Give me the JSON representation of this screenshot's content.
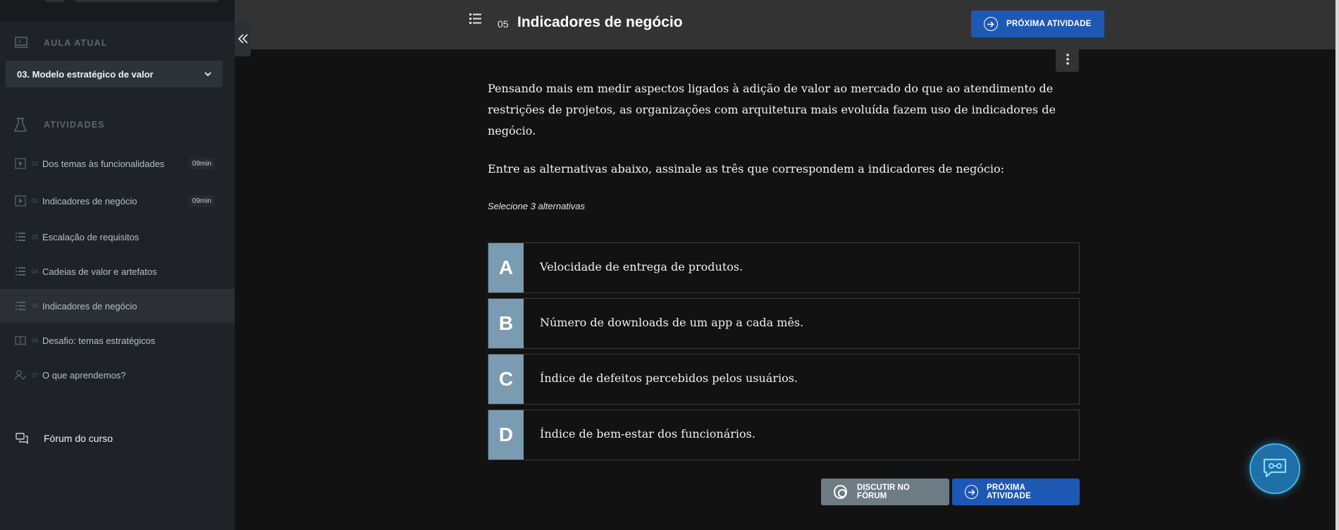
{
  "sidebar": {
    "current_lesson_label": "AULA ATUAL",
    "current_lesson_value": "03. Modelo estratégico de valor",
    "activities_label": "ATIVIDADES",
    "activities": [
      {
        "num": "01",
        "label": "Dos temas às funcionalidades",
        "duration": "09min",
        "icon": "play-icon"
      },
      {
        "num": "02",
        "label": "Indicadores de negócio",
        "duration": "09min",
        "icon": "play-icon"
      },
      {
        "num": "03",
        "label": "Escalação de requisitos",
        "duration": "",
        "icon": "list-icon"
      },
      {
        "num": "04",
        "label": "Cadeias de valor e artefatos",
        "duration": "",
        "icon": "list-icon"
      },
      {
        "num": "05",
        "label": "Indicadores de negócio",
        "duration": "",
        "icon": "list-icon"
      },
      {
        "num": "06",
        "label": "Desafio: temas estratégicos",
        "duration": "",
        "icon": "book-icon"
      },
      {
        "num": "07",
        "label": "O que aprendemos?",
        "duration": "",
        "icon": "user-check-icon"
      }
    ],
    "forum_label": "Fórum do curso"
  },
  "header": {
    "activity_num": "05",
    "activity_title": "Indicadores de negócio",
    "next_label": "PRÓXIMA ATIVIDADE"
  },
  "question": {
    "paragraph": "Pensando mais em medir aspectos ligados à adição de valor ao mercado do que ao atendimento de restrições de projetos, as organizações com arquitetura mais evoluída fazem uso de indicadores de negócio.",
    "prompt": "Entre as alternativas abaixo, assinale as três que correspondem a indicadores de negócio:",
    "hint": "Selecione 3 alternativas",
    "options": [
      {
        "letter": "A",
        "text": "Velocidade de entrega de produtos."
      },
      {
        "letter": "B",
        "text": "Número de downloads de um app a cada mês."
      },
      {
        "letter": "C",
        "text": "Índice de defeitos percebidos pelos usuários."
      },
      {
        "letter": "D",
        "text": "Índice de bem-estar dos funcionários."
      }
    ]
  },
  "footer": {
    "forum_button": "DISCUTIR NO FÓRUM",
    "next_button": "PRÓXIMA ATIVIDADE"
  },
  "colors": {
    "primary": "#1e58b5",
    "option_letter_bg": "#7a9bb1",
    "sidebar_bg": "#1f2327",
    "content_bg": "#121212"
  }
}
